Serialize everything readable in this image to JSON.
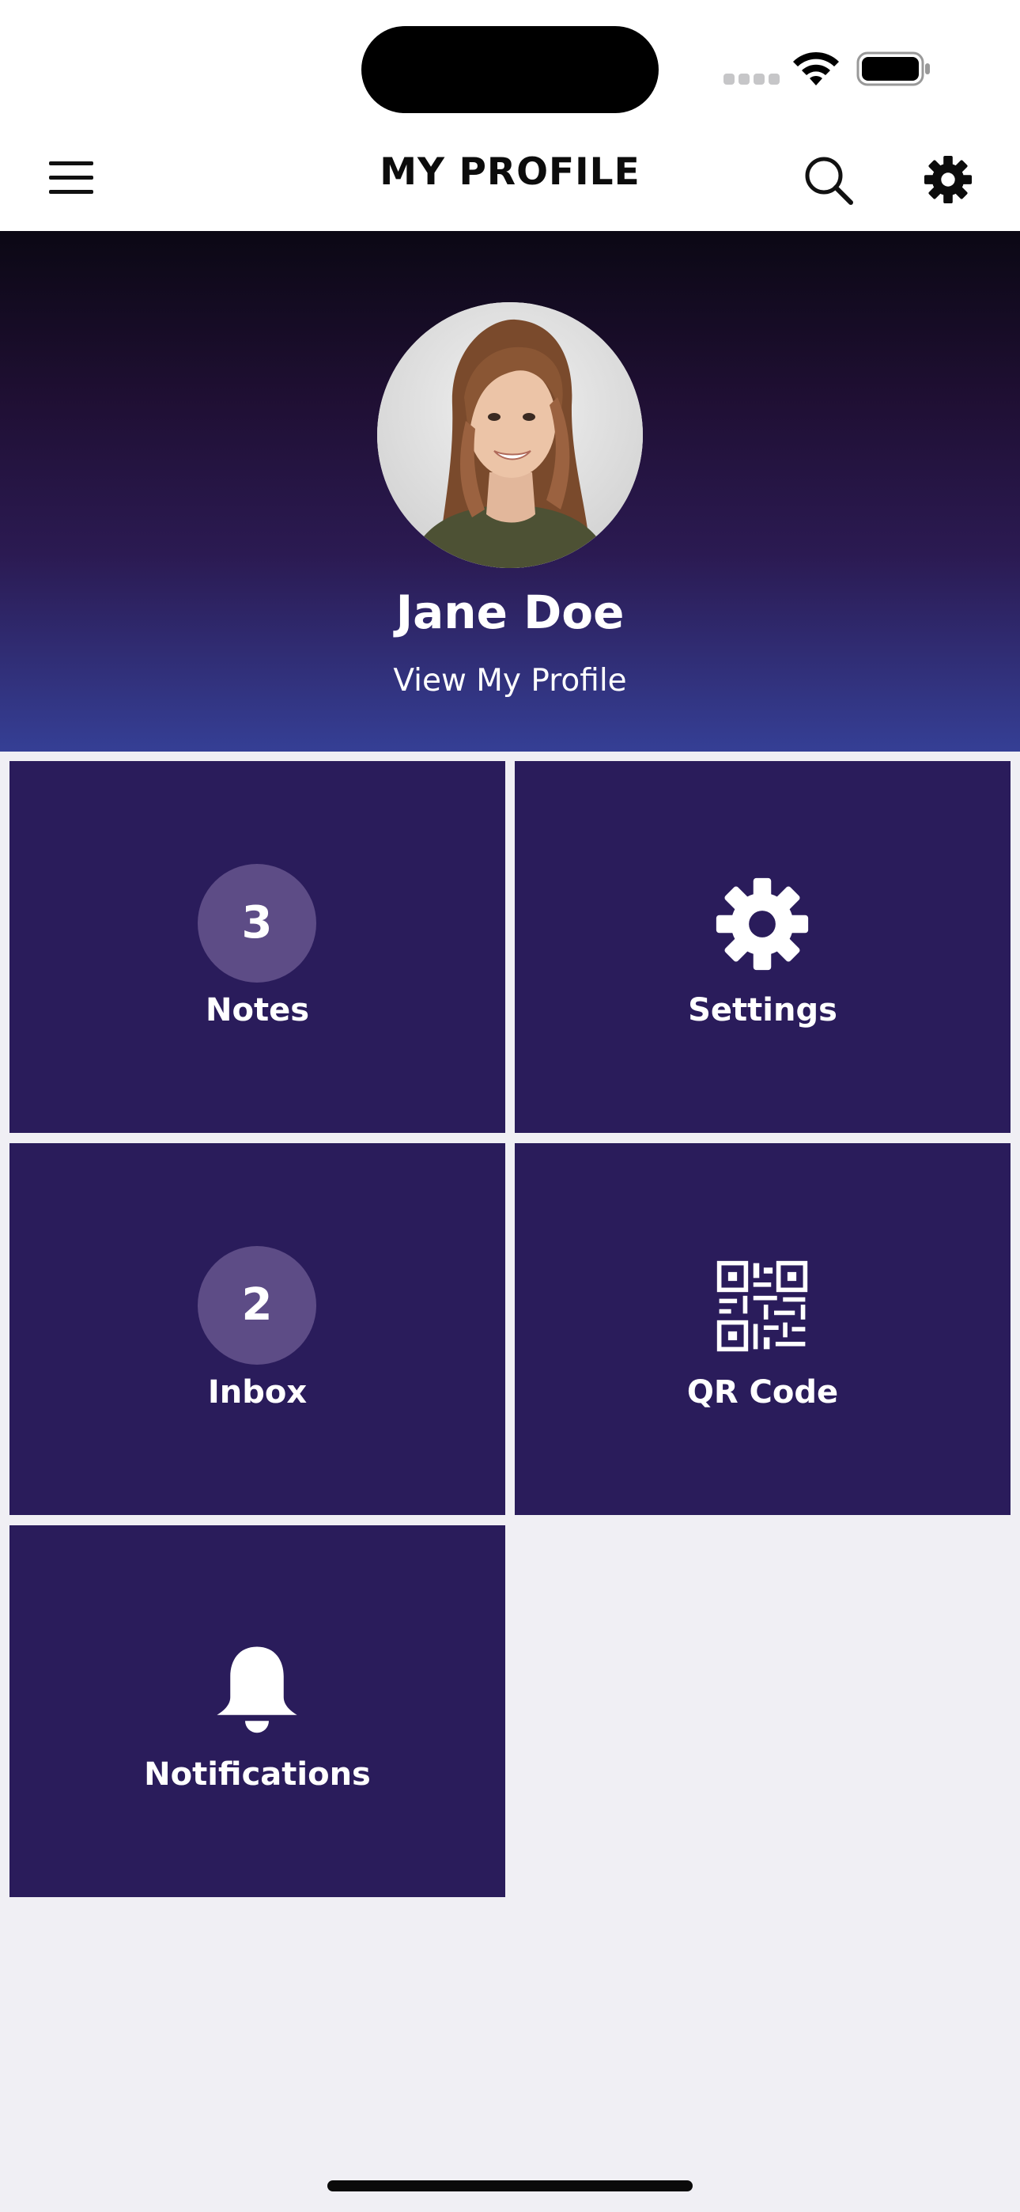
{
  "nav": {
    "title": "MY PROFILE",
    "icons": [
      "menu-icon",
      "search-icon",
      "gear-icon"
    ]
  },
  "profile": {
    "name": "Jane Doe",
    "link": "View My Profile",
    "avatar": "profile-photo"
  },
  "tiles": [
    {
      "label": "Notes",
      "badge": "3"
    },
    {
      "label": "Settings",
      "icon": "gear-icon"
    },
    {
      "label": "Inbox",
      "badge": "2"
    },
    {
      "label": "QR Code",
      "icon": "qr-code-icon"
    },
    {
      "label": "Notifications",
      "icon": "bell-icon"
    }
  ],
  "colors": {
    "tile_bg": "#2a1c5b",
    "badge_bg": "#5d4c86",
    "header_top": "#0b0814",
    "header_bottom": "#353f95",
    "page_bg": "#f0eff4"
  }
}
